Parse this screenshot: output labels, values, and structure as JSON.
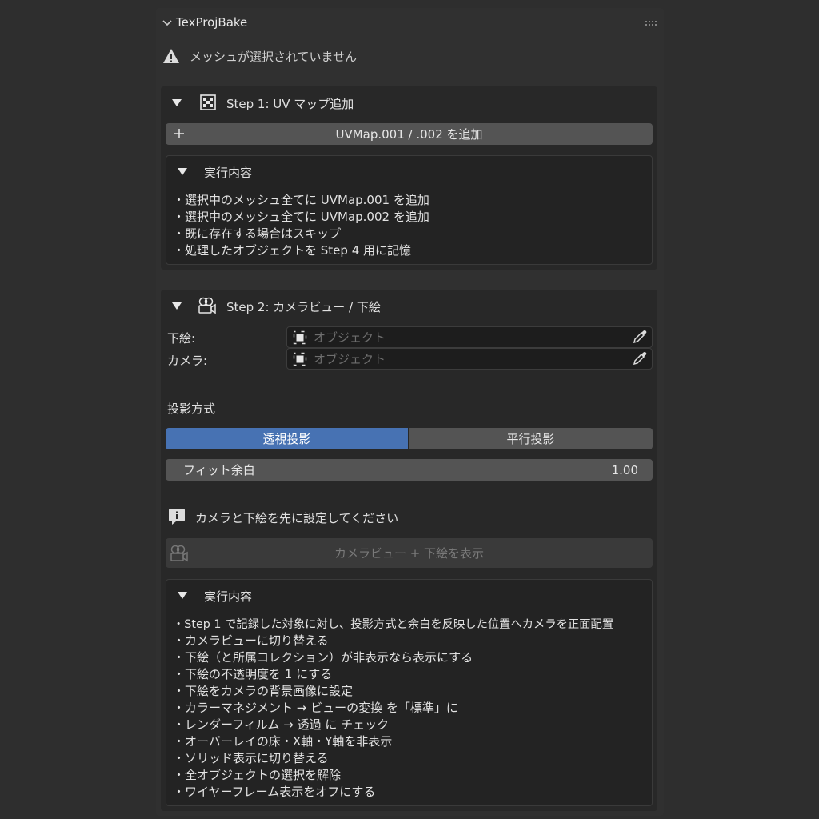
{
  "panel": {
    "title": "TexProjBake",
    "warning": "メッシュが選択されていません"
  },
  "step1": {
    "title": "Step 1: UV マップ追加",
    "button_label": "UVMap.001 / .002 を追加",
    "details_title": "実行内容",
    "lines": [
      "・選択中のメッシュ全てに UVMap.001 を追加",
      "・選択中のメッシュ全てに UVMap.002 を追加",
      "・既に存在する場合はスキップ",
      "・処理したオブジェクトを Step 4 用に記憶"
    ]
  },
  "step2": {
    "title": "Step 2: カメラビュー / 下絵",
    "fields": [
      {
        "label": "下絵:",
        "placeholder": "オブジェクト"
      },
      {
        "label": "カメラ:",
        "placeholder": "オブジェクト"
      }
    ],
    "projection_label": "投影方式",
    "projection_options": [
      "透視投影",
      "平行投影"
    ],
    "projection_selected": "透視投影",
    "fit_margin_label": "フィット余白",
    "fit_margin_value": "1.00",
    "info_text": "カメラと下絵を先に設定してください",
    "show_button_label": "カメラビュー + 下絵を表示",
    "details_title": "実行内容",
    "lines": [
      "・Step 1 で記録した対象に対し、投影方式と余白を反映した位置へカメラを正面配置",
      "・カメラビューに切り替える",
      "・下絵（と所属コレクション）が非表示なら表示にする",
      "・下絵の不透明度を 1 にする",
      "・下絵をカメラの背景画像に設定",
      "・カラーマネジメント → ビューの変換 を「標準」に",
      "・レンダーフィルム → 透過 に チェック",
      "・オーバーレイの床・X軸・Y軸を非表示",
      "・ソリッド表示に切り替える",
      "・全オブジェクトの選択を解除",
      "・ワイヤーフレーム表示をオフにする"
    ]
  },
  "icons": {
    "collapse": "chevron-down-icon",
    "warning": "warning-icon",
    "uv": "checker-icon",
    "camera": "camera-icon",
    "object": "object-icon",
    "eyedropper": "eyedropper-icon",
    "info": "info-icon",
    "add": "plus-icon"
  },
  "colors": {
    "accent": "#4772b3",
    "panel_bg": "#303030",
    "button_bg": "#545454"
  }
}
